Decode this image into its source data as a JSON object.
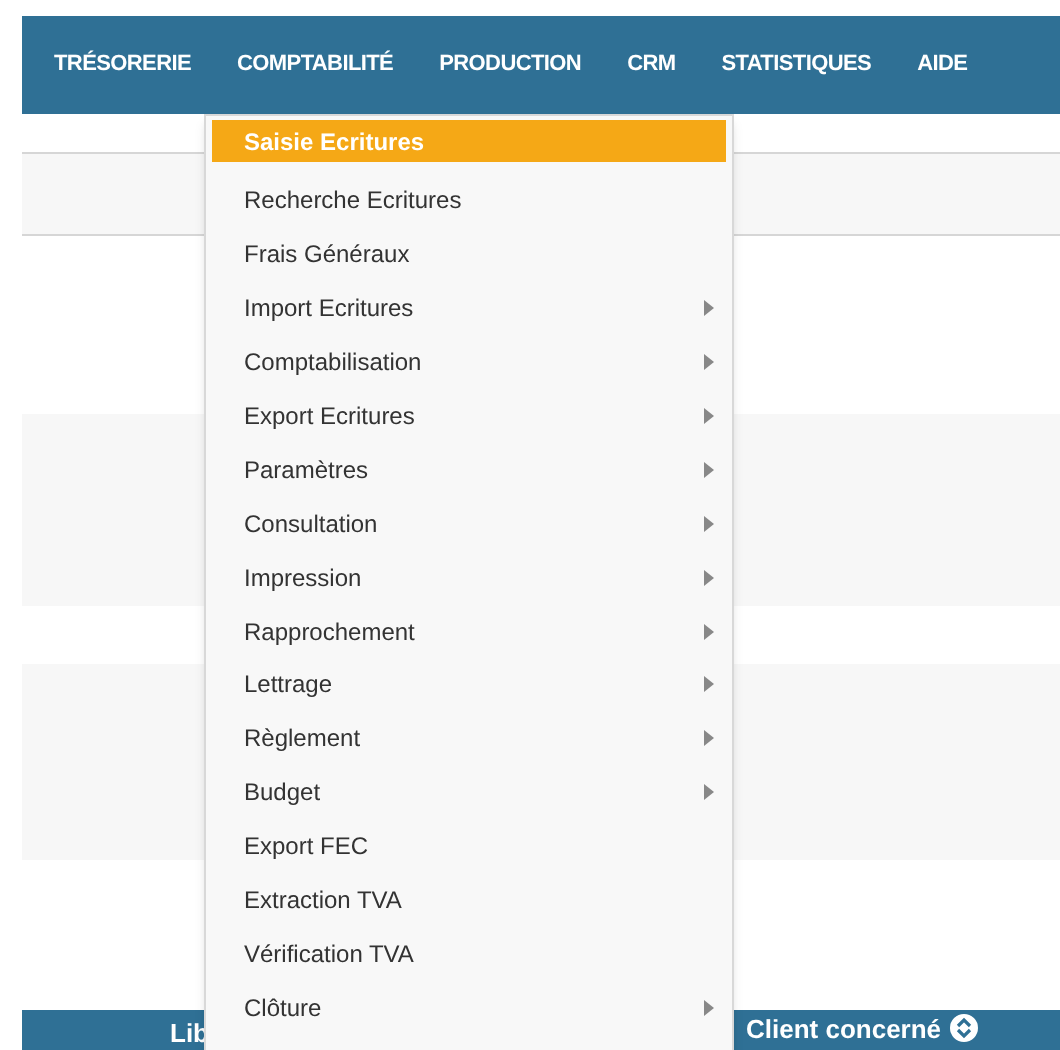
{
  "nav": {
    "items": [
      {
        "label": "TRÉSORERIE"
      },
      {
        "label": "COMPTABILITÉ"
      },
      {
        "label": "PRODUCTION"
      },
      {
        "label": "CRM"
      },
      {
        "label": "STATISTIQUES"
      },
      {
        "label": "AIDE"
      }
    ]
  },
  "menu": {
    "items": [
      {
        "label": "Saisie Ecritures",
        "selected": true,
        "submenu": false
      },
      {
        "label": "Recherche Ecritures",
        "selected": false,
        "submenu": false
      },
      {
        "label": "Frais Généraux",
        "selected": false,
        "submenu": false
      },
      {
        "label": "Import Ecritures",
        "selected": false,
        "submenu": true
      },
      {
        "label": "Comptabilisation",
        "selected": false,
        "submenu": true
      },
      {
        "label": "Export Ecritures",
        "selected": false,
        "submenu": true
      },
      {
        "label": "Paramètres",
        "selected": false,
        "submenu": true
      },
      {
        "label": "Consultation",
        "selected": false,
        "submenu": true
      },
      {
        "label": "Impression",
        "selected": false,
        "submenu": true
      },
      {
        "label": "Rapprochement",
        "selected": false,
        "submenu": true
      },
      {
        "label": "Lettrage",
        "selected": false,
        "submenu": true
      },
      {
        "label": "Règlement",
        "selected": false,
        "submenu": true
      },
      {
        "label": "Budget",
        "selected": false,
        "submenu": true
      },
      {
        "label": "Export FEC",
        "selected": false,
        "submenu": false
      },
      {
        "label": "Extraction TVA",
        "selected": false,
        "submenu": false
      },
      {
        "label": "Vérification TVA",
        "selected": false,
        "submenu": false
      },
      {
        "label": "Clôture",
        "selected": false,
        "submenu": true
      }
    ]
  },
  "table_header": {
    "column_1": "Lib",
    "column_2": "Client concerné"
  }
}
